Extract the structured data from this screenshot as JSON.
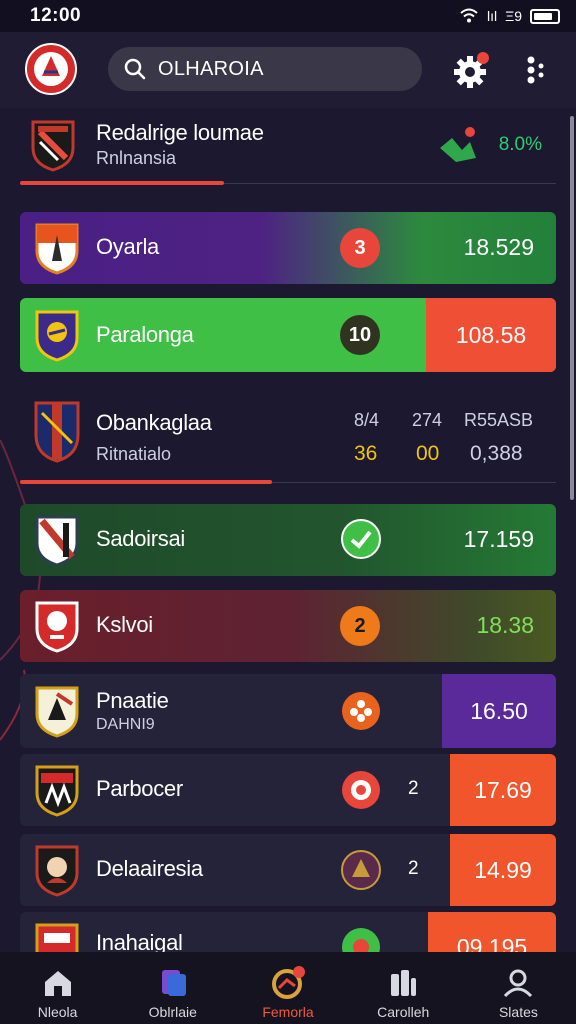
{
  "status_bar": {
    "time": "12:00",
    "signal_text": "lıl",
    "extra_text": "Ξ9"
  },
  "header": {
    "search_value": "OLHAROIA",
    "notification_dot_color": "#e8463b"
  },
  "featured": {
    "name": "Redalrige loumae",
    "subtitle": "Rnlnansia",
    "percent": "8.0%",
    "progress": 0.38
  },
  "rows": [
    {
      "name": "Oyarla",
      "badge": "3",
      "value": "18.529"
    },
    {
      "name": "Paralonga",
      "badge": "10",
      "value": "108.58"
    },
    {
      "name": "Sadoirsai",
      "badge_icon": "check-icon",
      "value": "17.159"
    },
    {
      "name": "Kslvoi",
      "badge": "2",
      "value": "18.38"
    },
    {
      "name": "Pnaatie",
      "subtitle": "DAHNI9",
      "badge_icon": "flower-icon",
      "value": "16.50"
    },
    {
      "name": "Parbocer",
      "badge_icon": "record-icon",
      "count": "2",
      "value": "17.69"
    },
    {
      "name": "Delaairesia",
      "badge_icon": "shield-icon",
      "count": "2",
      "value": "14.99"
    },
    {
      "name": "Inahaigal",
      "badge_icon": "flower-icon",
      "value": "09.195"
    }
  ],
  "detail": {
    "name": "Obankaglaa",
    "subtitle": "Ritnatialo",
    "columns": [
      {
        "header": "8/4",
        "value": "36"
      },
      {
        "header": "274",
        "value": "00"
      },
      {
        "header": "R55ASB",
        "value": "0,388"
      }
    ],
    "progress": 0.47
  },
  "nav": [
    {
      "label": "Nleola",
      "icon": "home-icon"
    },
    {
      "label": "Oblrlaie",
      "icon": "cards-icon"
    },
    {
      "label": "Femorla",
      "icon": "target-icon",
      "active": true
    },
    {
      "label": "Carolleh",
      "icon": "stats-icon"
    },
    {
      "label": "Slates",
      "icon": "user-icon"
    }
  ],
  "colors": {
    "background": "#1b1830",
    "accent": "#e8463b",
    "green": "#34a853",
    "purple": "#5a2a9a",
    "orange_red": "#f0552c",
    "gold": "#f1c40f"
  }
}
